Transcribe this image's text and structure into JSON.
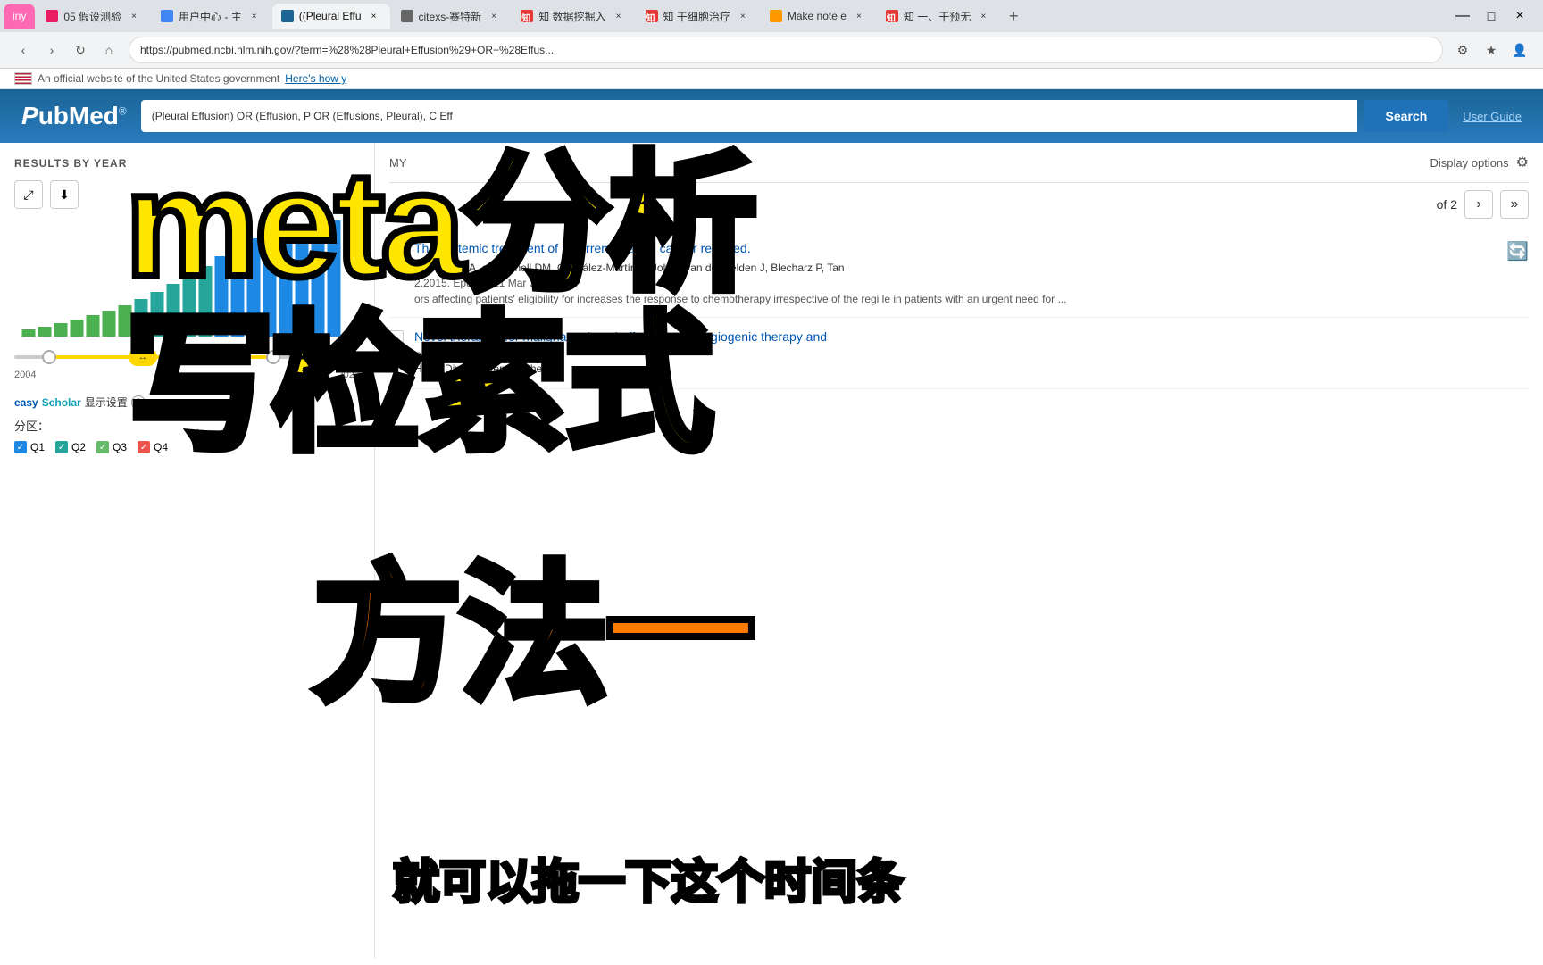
{
  "browser": {
    "tabs": [
      {
        "id": "tab1",
        "label": "05 假设测验",
        "favicon_color": "#ff69b4",
        "active": false
      },
      {
        "id": "tab2",
        "label": "用户中心 - 主",
        "favicon_color": "#4285f4",
        "active": false
      },
      {
        "id": "tab3",
        "label": "((Pleural Effu",
        "favicon_color": "#1a6496",
        "active": true
      },
      {
        "id": "tab4",
        "label": "citexs-赛特新",
        "favicon_color": "#666",
        "active": false
      },
      {
        "id": "tab5",
        "label": "知 数据挖掘入",
        "favicon_color": "#e53935",
        "active": false
      },
      {
        "id": "tab6",
        "label": "知 干细胞治疗",
        "favicon_color": "#e53935",
        "active": false
      },
      {
        "id": "tab7",
        "label": "Make note e",
        "favicon_color": "#ff9800",
        "active": false
      },
      {
        "id": "tab8",
        "label": "知 一、干预无",
        "favicon_color": "#e53935",
        "active": false
      }
    ],
    "url": "https://pubmed.ncbi.nlm.nih.gov/?term=%28%28Pleural+Effusion%29+OR+%28Effus...",
    "new_tab_label": "+"
  },
  "official_banner": {
    "text": "An official website of the United States government",
    "heres_how": "Here's how y"
  },
  "pubmed": {
    "logo": "PubMed",
    "search_query": "(Pleural Effusion) OR (Effusion, P     OR (Effusions, Pleural), C     Eff",
    "search_button_label": "Search",
    "user_guide_label": "User Guide"
  },
  "results_header": {
    "my_ncbi_label": "MY",
    "display_options_label": "Display options",
    "of_text": "of 2",
    "pagination_next": "›",
    "pagination_last": "»"
  },
  "chart": {
    "title": "RESULTS BY YEAR",
    "year_start": "2004",
    "year_end": "2023",
    "expand_icon": "⤢",
    "download_icon": "⬇",
    "bars": [
      3,
      4,
      5,
      6,
      7,
      8,
      9,
      10,
      12,
      14,
      16,
      18,
      20,
      22,
      24,
      28,
      30,
      32,
      34,
      36
    ],
    "bar_colors": [
      "#4caf50",
      "#4caf50",
      "#4caf50",
      "#4caf50",
      "#4caf50",
      "#4caf50",
      "#4caf50",
      "#4caf50",
      "#4caf50",
      "#4caf50",
      "#26a69a",
      "#26a69a",
      "#26a69a",
      "#26a69a",
      "#1e88e5",
      "#1e88e5",
      "#1e88e5",
      "#1e88e5",
      "#1e88e5",
      "#1e88e5"
    ]
  },
  "easy_scholar": {
    "easy_part": "easy",
    "scholar_part": "Scholar",
    "display_label": "显示设置",
    "help_icon": "?"
  },
  "fenjou": {
    "label": "分区：",
    "checkboxes": [
      {
        "label": "Q1",
        "color": "#1e88e5",
        "checked": true
      },
      {
        "label": "Q2",
        "color": "#26a69a",
        "checked": true
      },
      {
        "label": "Q3",
        "color": "#66bb6a",
        "checked": true
      },
      {
        "label": "Q4",
        "color": "#ef5350",
        "checked": true
      }
    ]
  },
  "articles": [
    {
      "title": "The systemic treatment of recurrent ovarian cancer revisited.",
      "authors": "t T, Ferrero A, abou     nnell DM, González-Martín A, Joly F, van der Velden J, Blecharz P, Tan",
      "journal": "2.2015. Epub 2021 Mar 3.",
      "snippet": "ors affecting patients' eligibility for\nincreases the response to chemotherapy irrespective of the\nregi      le in patients with an urgent need for ...",
      "has_icon": true
    },
    {
      "title": "Novel therapies for malignant pleural effusion: Anti-angiogenic therapy and",
      "authors": "He D, Ding R, Wen Q, Chen L.",
      "journal": "",
      "snippet": "",
      "cite_label": "Cite"
    }
  ],
  "overlay": {
    "title_line1": "meta分析",
    "title_line2": "写检索式",
    "method": "方法一",
    "subtitle": "就可以拖一下这个时间条",
    "pink_badge": "iny"
  }
}
